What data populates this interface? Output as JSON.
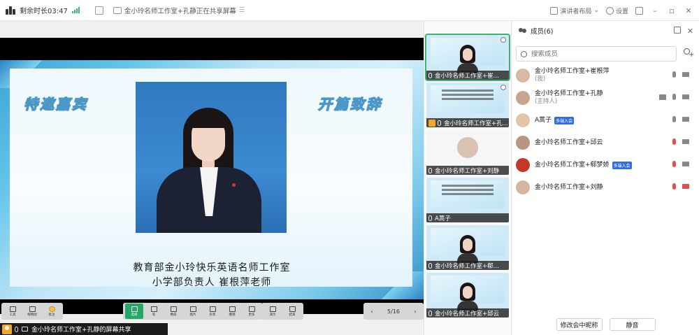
{
  "topbar": {
    "remaining_label": "剩余时长03:47",
    "share_title": "金小玲名师工作室+孔静正在共享屏幕",
    "layout_label": "演讲者布局",
    "settings_label": "设置"
  },
  "slide": {
    "slogan_left": "特邀嘉宾",
    "slogan_right": "开篇致辞",
    "caption_line1": "教育部金小玲快乐英语名师工作室",
    "caption_line2": "小学部负责人  崔根萍老师"
  },
  "toolbar": {
    "tools": [
      {
        "label": "工具"
      },
      {
        "label": "缩略图"
      },
      {
        "label": "批注"
      }
    ],
    "draw_tools": [
      {
        "label": "选择",
        "active": true
      },
      {
        "label": "笔"
      },
      {
        "label": "橡皮"
      },
      {
        "label": "图片"
      },
      {
        "label": "形状"
      },
      {
        "label": "撤销"
      },
      {
        "label": "更多"
      }
    ],
    "right_tools": [
      {
        "label": "演示"
      },
      {
        "label": "结束"
      }
    ],
    "pager": {
      "current": "5/16"
    }
  },
  "sharebar": {
    "text": "金小玲名师工作室+孔静的屏幕共享"
  },
  "thumbnails": [
    {
      "label": "金小玲名师工作室+崔..."
    },
    {
      "label": "金小玲名师工作室+孔..."
    },
    {
      "label": "金小玲名师工作室+刘静"
    },
    {
      "label": "A蒿子"
    },
    {
      "label": "金小玲名师工作室+郗..."
    },
    {
      "label": "金小玲名师工作室+邱云"
    }
  ],
  "panel": {
    "title": "成员(6)",
    "search_placeholder": "搜索成员",
    "members": [
      {
        "name": "金小玲名师工作室+崔根萍",
        "role": "(我)",
        "badge": ""
      },
      {
        "name": "金小玲名师工作室+孔静",
        "role": "(主持人)",
        "badge": ""
      },
      {
        "name": "A蒿子",
        "role": "",
        "badge": "多端入会"
      },
      {
        "name": "金小玲名师工作室+邱云",
        "role": "",
        "badge": ""
      },
      {
        "name": "金小玲名师工作室+郗梦娇",
        "role": "",
        "badge": "多端入会"
      },
      {
        "name": "金小玲名师工作室+刘静",
        "role": "",
        "badge": ""
      }
    ],
    "rename_button": "修改会中昵称",
    "mute_all_button": "静音"
  },
  "colors": {
    "accent_green": "#25a866",
    "mute_red": "#e05050",
    "badge_blue": "#2f6de8"
  }
}
